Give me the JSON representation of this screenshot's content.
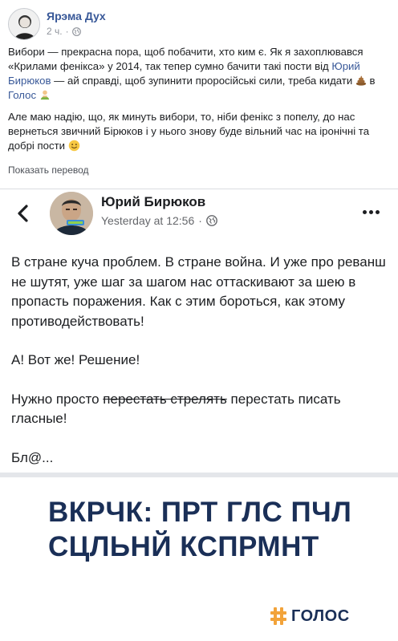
{
  "outer_post": {
    "author": "Ярэма Дух",
    "time": "2 ч.",
    "meta_separator": "·",
    "globe_icon": "globe-icon",
    "para1": {
      "before_link": "Вибори — прекрасна пора, щоб побачити, хто ким є. Як я захоплювався «Крилами фенікса» у 2014, так тепер сумно бачити такі пости від ",
      "link": "Юрий Бирюков",
      "after_link": " — ай справді, щоб зупинити проросійські сили, треба кидати ",
      "before_golos": " в ",
      "golos_link": "Голос",
      "end": ""
    },
    "para2": "Але маю надію, що, як минуть вибори, то, ніби фенікс з попелу, до нас вернеться звичний Бірюков і у нього знову буде вільний час на іронічні та добрі пости",
    "translate_label": "Показать перевод"
  },
  "embedded_post": {
    "author": "Юрий Бирюков",
    "time": "Yesterday at 12:56",
    "meta_separator": "·",
    "p1": "В стране куча проблем. В стране война. И уже про реванш не шутят, уже шаг за шагом нас оттаскивают за шею в пропасть поражения. Как с этим бороться, как этому противодействовать!",
    "p2": "А! Вот же! Решение!",
    "p3_before": "Нужно просто ",
    "p3_strike": "перестать стрелять",
    "p3_after": " перестать писать гласные!",
    "p4": "Бл@..."
  },
  "banner": {
    "line1": "ВКРЧК: ПРТ ГЛС ПЧЛ",
    "line2": "СЦЛЬНЙ КСПРМНТ",
    "brand": "ГОЛОС"
  },
  "colors": {
    "link": "#385898",
    "banner_text": "#1a2f57",
    "brand_orange": "#f2a33a"
  }
}
